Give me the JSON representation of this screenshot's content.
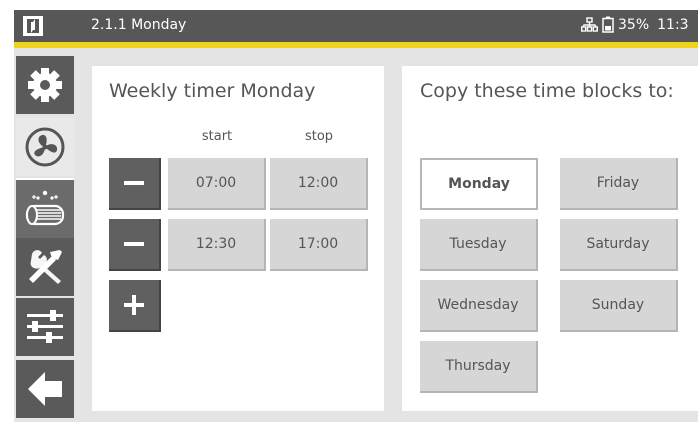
{
  "header": {
    "title": "2.1.1 Monday",
    "battery": "35%",
    "time": "11:3"
  },
  "colors": {
    "accent": "#f2d31b",
    "topbar": "#575757",
    "sidebar": "#5a5a5a"
  },
  "sidebar": [
    {
      "icon": "gear-icon"
    },
    {
      "icon": "fan-icon"
    },
    {
      "icon": "air-treatment-icon"
    },
    {
      "icon": "tools-icon"
    },
    {
      "icon": "sliders-icon"
    },
    {
      "icon": "back-arrow-icon"
    }
  ],
  "timer": {
    "title": "Weekly timer Monday",
    "start_label": "start",
    "stop_label": "stop",
    "blocks": [
      {
        "start": "07:00",
        "stop": "12:00"
      },
      {
        "start": "12:30",
        "stop": "17:00"
      }
    ]
  },
  "copy": {
    "title": "Copy these time blocks to:",
    "days": [
      "Monday",
      "Friday",
      "Tuesday",
      "Saturday",
      "Wednesday",
      "Sunday",
      "Thursday"
    ],
    "selected": "Monday"
  }
}
